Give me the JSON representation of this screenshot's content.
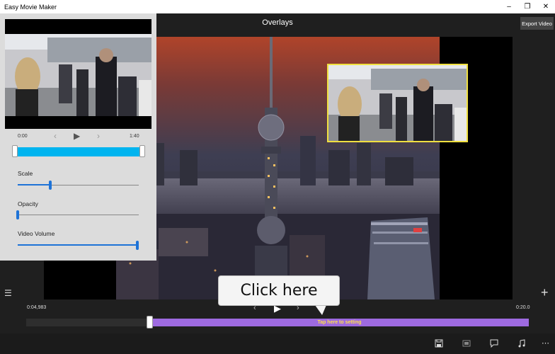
{
  "window": {
    "title": "Easy Movie Maker",
    "minimize_glyph": "–",
    "restore_glyph": "❐",
    "close_glyph": "✕"
  },
  "header": {
    "page_title": "Overlays",
    "export_label": "Export Video"
  },
  "panel": {
    "time_start": "0:00",
    "time_end": "1:40",
    "prev_glyph": "‹",
    "play_glyph": "▶",
    "next_glyph": "›",
    "sliders": [
      {
        "label": "Scale",
        "value": 0.27
      },
      {
        "label": "Opacity",
        "value": 0.0
      },
      {
        "label": "Video Volume",
        "value": 1.0
      }
    ]
  },
  "playback": {
    "current_time": "0:04,983",
    "end_time": "0:20.0",
    "prev_glyph": "‹",
    "play_glyph": "▶",
    "next_glyph": "›",
    "segment_label": "Tap here to setting",
    "progress": 0.245
  },
  "callout": {
    "text": "Click  here"
  },
  "icons": {
    "list": "☰",
    "add": "+",
    "more": "⋯"
  },
  "toolbar": {
    "buttons": [
      "save-icon",
      "film-icon",
      "comment-icon",
      "music-icon",
      "more-icon"
    ]
  },
  "colors": {
    "accent_blue": "#1e73d7",
    "range_cyan": "#00b4ef",
    "segment_purple": "#9e6ae0",
    "segment_text": "#fde04c",
    "overlay_border": "#f0e040"
  }
}
